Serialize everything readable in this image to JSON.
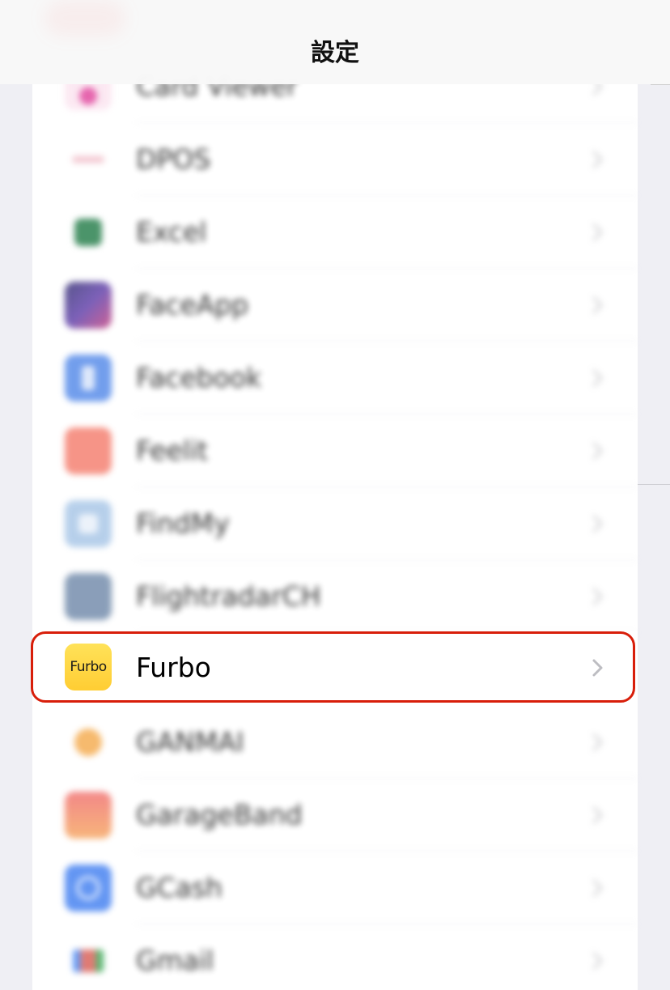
{
  "header": {
    "title": "設定"
  },
  "apps": [
    {
      "label": "Card Viewer",
      "icon_name": "card-viewer-icon",
      "icon_color": "#e0409a",
      "blurred": true
    },
    {
      "label": "DPOS",
      "icon_name": "dpos-icon",
      "icon_color": "#f1b8c4",
      "blurred": true
    },
    {
      "label": "Excel",
      "icon_name": "excel-icon",
      "icon_color": "#1f7a45",
      "blurred": true
    },
    {
      "label": "FaceApp",
      "icon_name": "faceapp-icon",
      "icon_color": "#5b3aa8",
      "blurred": true
    },
    {
      "label": "Facebook",
      "icon_name": "facebook-icon",
      "icon_color": "#4f86e8",
      "blurred": true
    },
    {
      "label": "Feelit",
      "icon_name": "feelit-icon",
      "icon_color": "#f47a6a",
      "blurred": true
    },
    {
      "label": "FindMy",
      "icon_name": "findmy-icon",
      "icon_color": "#a5c4e6",
      "blurred": true
    },
    {
      "label": "FlightradarCH",
      "icon_name": "flightradar-icon",
      "icon_color": "#6d87a8",
      "blurred": true
    },
    {
      "label": "Furbo",
      "icon_name": "furbo-icon",
      "icon_text": "Furbo",
      "icon_color": "#ffd43d",
      "blurred": false,
      "highlighted": true
    },
    {
      "label": "GANMAI",
      "icon_name": "ganmai-icon",
      "icon_color": "#f5a94a",
      "blurred": true
    },
    {
      "label": "GarageBand",
      "icon_name": "garageband-icon",
      "icon_color": "#f08a6a",
      "blurred": true
    },
    {
      "label": "GCash",
      "icon_name": "gcash-icon",
      "icon_color": "#3d7cf0",
      "blurred": true
    },
    {
      "label": "Gmail",
      "icon_name": "gmail-icon",
      "icon_color": "#d95b52",
      "blurred": true
    }
  ],
  "colors": {
    "highlight_border": "#d81e0a",
    "chevron": "#c4c4c7"
  }
}
